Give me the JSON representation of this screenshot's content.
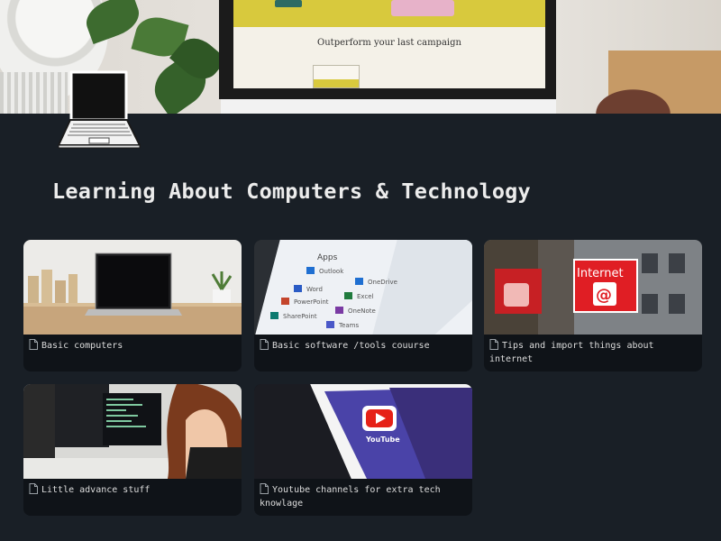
{
  "cover": {
    "screen_text": "Outperform your last campaign"
  },
  "page": {
    "title": "Learning About Computers & Technology",
    "icon": "laptop-icon"
  },
  "gallery": {
    "cards": [
      {
        "title": "Basic computers",
        "icon": "document-icon",
        "image": "laptop-on-desk-photo"
      },
      {
        "title": "Basic software /tools couurse",
        "icon": "document-icon",
        "image": "office-apps-tablet-photo"
      },
      {
        "title": "Tips and import things about internet",
        "icon": "document-icon",
        "image": "internet-sign-photo"
      },
      {
        "title": "Little advance stuff",
        "icon": "document-icon",
        "image": "person-at-monitors-photo"
      },
      {
        "title": "Youtube channels for extra tech knowlage",
        "icon": "document-icon",
        "image": "youtube-phone-photo"
      }
    ]
  }
}
